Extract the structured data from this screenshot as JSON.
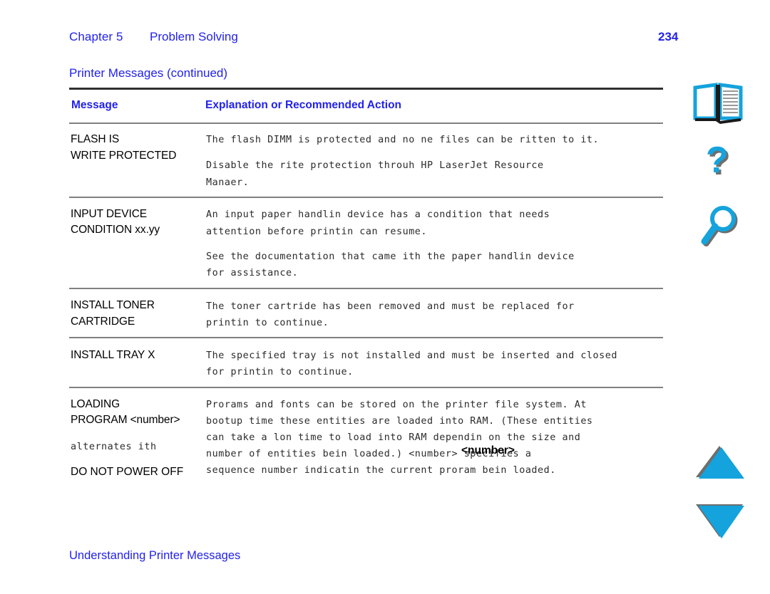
{
  "header": {
    "chapter_label": "Chapter 5",
    "chapter_title": "Problem Solving",
    "page_number": "234"
  },
  "table": {
    "title": "Printer Messages (continued)",
    "columns": {
      "message": "Message",
      "explanation": "Explanation or Recommended Action"
    },
    "rows": [
      {
        "message_lines": [
          "FLASH IS",
          "WRITE PROTECTED"
        ],
        "body_lines": [
          "The flash DIMM is protected and no ne files can be ritten to it.",
          "",
          "Disable the rite protection throuh HP LaserJet Resource",
          "Manaer."
        ]
      },
      {
        "message_lines": [
          "INPUT DEVICE",
          "CONDITION xx.yy"
        ],
        "body_lines": [
          "An input paper handlin device has a condition that needs",
          "attention before printin can resume.",
          "",
          "See the documentation that came ith the paper handlin device",
          "for assistance."
        ]
      },
      {
        "message_lines": [
          "INSTALL TONER",
          "CARTRIDGE"
        ],
        "body_lines": [
          "The toner cartride has been removed and must be replaced for",
          "printin to continue."
        ]
      },
      {
        "message_lines": [
          "INSTALL TRAY X"
        ],
        "body_lines": [
          "The specified tray is not installed and must be inserted and closed",
          "for printin to continue."
        ]
      },
      {
        "message_lines": [
          "LOADING",
          "PROGRAM <number>"
        ],
        "message_mono": "alternates ith",
        "message_lines_2": [
          "DO NOT POWER OFF"
        ],
        "body_lines": [
          "Prorams and fonts can be stored on the printer file system. At",
          "bootup time these entities are loaded into RAM. (These entities",
          "can take a lon time to load into RAM dependin on the size and",
          "number of entities bein loaded.) <number> specifies a",
          "sequence number indicatin the current proram bein loaded."
        ],
        "inline_bold_placeholder": "<number>"
      }
    ]
  },
  "footer": {
    "text": "Understanding Printer Messages"
  },
  "rail": {
    "icons": [
      {
        "name": "book-icon",
        "label": "Contents"
      },
      {
        "name": "question-mark-icon",
        "label": "Help"
      },
      {
        "name": "magnifier-icon",
        "label": "Search"
      },
      {
        "name": "triangle-up-icon",
        "label": "Previous page"
      },
      {
        "name": "triangle-down-icon",
        "label": "Next page"
      }
    ]
  },
  "colors": {
    "link_blue": "#2222ee",
    "icon_cyan": "#14a3dc",
    "icon_shadow": "#6e6e6e",
    "rule_gray": "#808080",
    "rule_dark": "#303030"
  }
}
